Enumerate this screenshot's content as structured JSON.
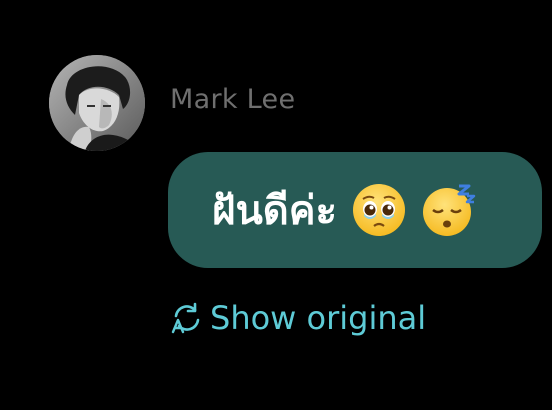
{
  "message": {
    "sender_name": "Mark Lee",
    "text": "ฝันดีค่ะ",
    "emojis": [
      "pleading-face",
      "sleeping-face"
    ]
  },
  "translation": {
    "toggle_label": "Show original",
    "icon": "translate-refresh-icon"
  },
  "colors": {
    "background": "#000000",
    "bubble": "#275a55",
    "sender_name": "#6f6f6f",
    "link": "#5ecbd6",
    "message_text": "#ffffff"
  }
}
